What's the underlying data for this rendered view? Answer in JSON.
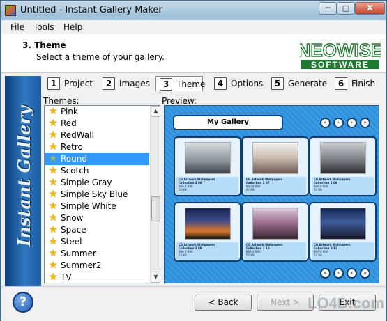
{
  "window": {
    "title": "Untitled - Instant Gallery Maker",
    "min_label": "─",
    "max_label": "□",
    "close_label": "X"
  },
  "menu": [
    "File",
    "Tools",
    "Help"
  ],
  "header": {
    "step_title": "3. Theme",
    "step_subtitle": "Select a theme of your gallery.",
    "logo_line1": "NEOWISE",
    "logo_line2": "SOFTWARE"
  },
  "sidebar_text": "Instant Gallery Maker",
  "tabs": [
    {
      "num": "1",
      "label": "Project"
    },
    {
      "num": "2",
      "label": "Images"
    },
    {
      "num": "3",
      "label": "Theme"
    },
    {
      "num": "4",
      "label": "Options"
    },
    {
      "num": "5",
      "label": "Generate"
    },
    {
      "num": "6",
      "label": "Finish"
    }
  ],
  "themes_label": "Themes:",
  "preview_label": "Preview:",
  "themes": [
    "Pink",
    "Red",
    "RedWall",
    "Retro",
    "Round",
    "Scotch",
    "Simple Gray",
    "Simple Sky Blue",
    "Simple White",
    "Snow",
    "Space",
    "Steel",
    "Summer",
    "Summer2",
    "TV"
  ],
  "selected_theme": "Round",
  "preview": {
    "gallery_title": "My Gallery",
    "nav": [
      "«",
      "‹",
      "›",
      "»"
    ],
    "thumbnails": [
      {
        "line1": "CG Artwork Wallpapers",
        "line2": "Collection 3 06",
        "dims": "800 X 600",
        "size": "53 KB"
      },
      {
        "line1": "CG Artwork Wallpapers",
        "line2": "Collection 3 07",
        "dims": "800 X 600",
        "size": "47 KB"
      },
      {
        "line1": "CG Artwork Wallpapers",
        "line2": "Collection 3 08",
        "dims": "800 X 600",
        "size": "53 KB"
      },
      {
        "line1": "CG Artwork Wallpapers",
        "line2": "Collection 3 09",
        "dims": "800 X 600",
        "size": "53 KB"
      },
      {
        "line1": "CG Artwork Wallpapers",
        "line2": "Collection 3 10",
        "dims": "800 X 600",
        "size": "52 KB"
      },
      {
        "line1": "CG Artwork Wallpapers",
        "line2": "Collection 3 11",
        "dims": "800 X 600",
        "size": "52 KB"
      }
    ]
  },
  "footer": {
    "help": "?",
    "back": "< Back",
    "next": "Next >",
    "exit": "Exit"
  },
  "watermark": "LO4D.com"
}
